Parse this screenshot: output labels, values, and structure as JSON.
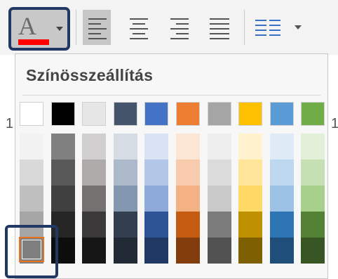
{
  "toolbar": {
    "font_color": {
      "letter": "A",
      "underline_color": "#ff0000",
      "icon": "font-color-icon"
    },
    "alignment_buttons": [
      "align-left",
      "align-center",
      "align-right",
      "justify"
    ],
    "columns_icon": "columns-icon"
  },
  "ruler": {
    "left_number": "1",
    "right_number": "1"
  },
  "color_panel": {
    "title": "Színösszeállítás",
    "base_colors": [
      "#ffffff",
      "#000000",
      "#e7e6e6",
      "#44546a",
      "#4472c4",
      "#ed7d31",
      "#a5a5a5",
      "#ffc000",
      "#5b9bd5",
      "#70ad47"
    ],
    "shades": [
      [
        "#f2f2f2",
        "#d9d9d9",
        "#bfbfbf",
        "#a6a6a6",
        "#7f7f7f"
      ],
      [
        "#808080",
        "#595959",
        "#404040",
        "#262626",
        "#0d0d0d"
      ],
      [
        "#d0cece",
        "#aeaaaa",
        "#757171",
        "#3a3838",
        "#171616"
      ],
      [
        "#d6dce4",
        "#acb9ca",
        "#8497b0",
        "#333f4f",
        "#222a35"
      ],
      [
        "#d9e2f3",
        "#b4c6e7",
        "#8eaadb",
        "#2f5496",
        "#1f3864"
      ],
      [
        "#fbe5d5",
        "#f7cbac",
        "#f4b183",
        "#c55a11",
        "#833c0b"
      ],
      [
        "#ededed",
        "#dbdbdb",
        "#c9c9c9",
        "#7b7b7b",
        "#525252"
      ],
      [
        "#fff2cc",
        "#fee599",
        "#ffd965",
        "#bf9000",
        "#7f6000"
      ],
      [
        "#deeaf6",
        "#bdd7ee",
        "#9cc2e5",
        "#2e75b5",
        "#1e4e79"
      ],
      [
        "#e2efd9",
        "#c5e0b3",
        "#a8d08d",
        "#538135",
        "#375623"
      ]
    ],
    "selected_color": "#7f7f7f"
  }
}
